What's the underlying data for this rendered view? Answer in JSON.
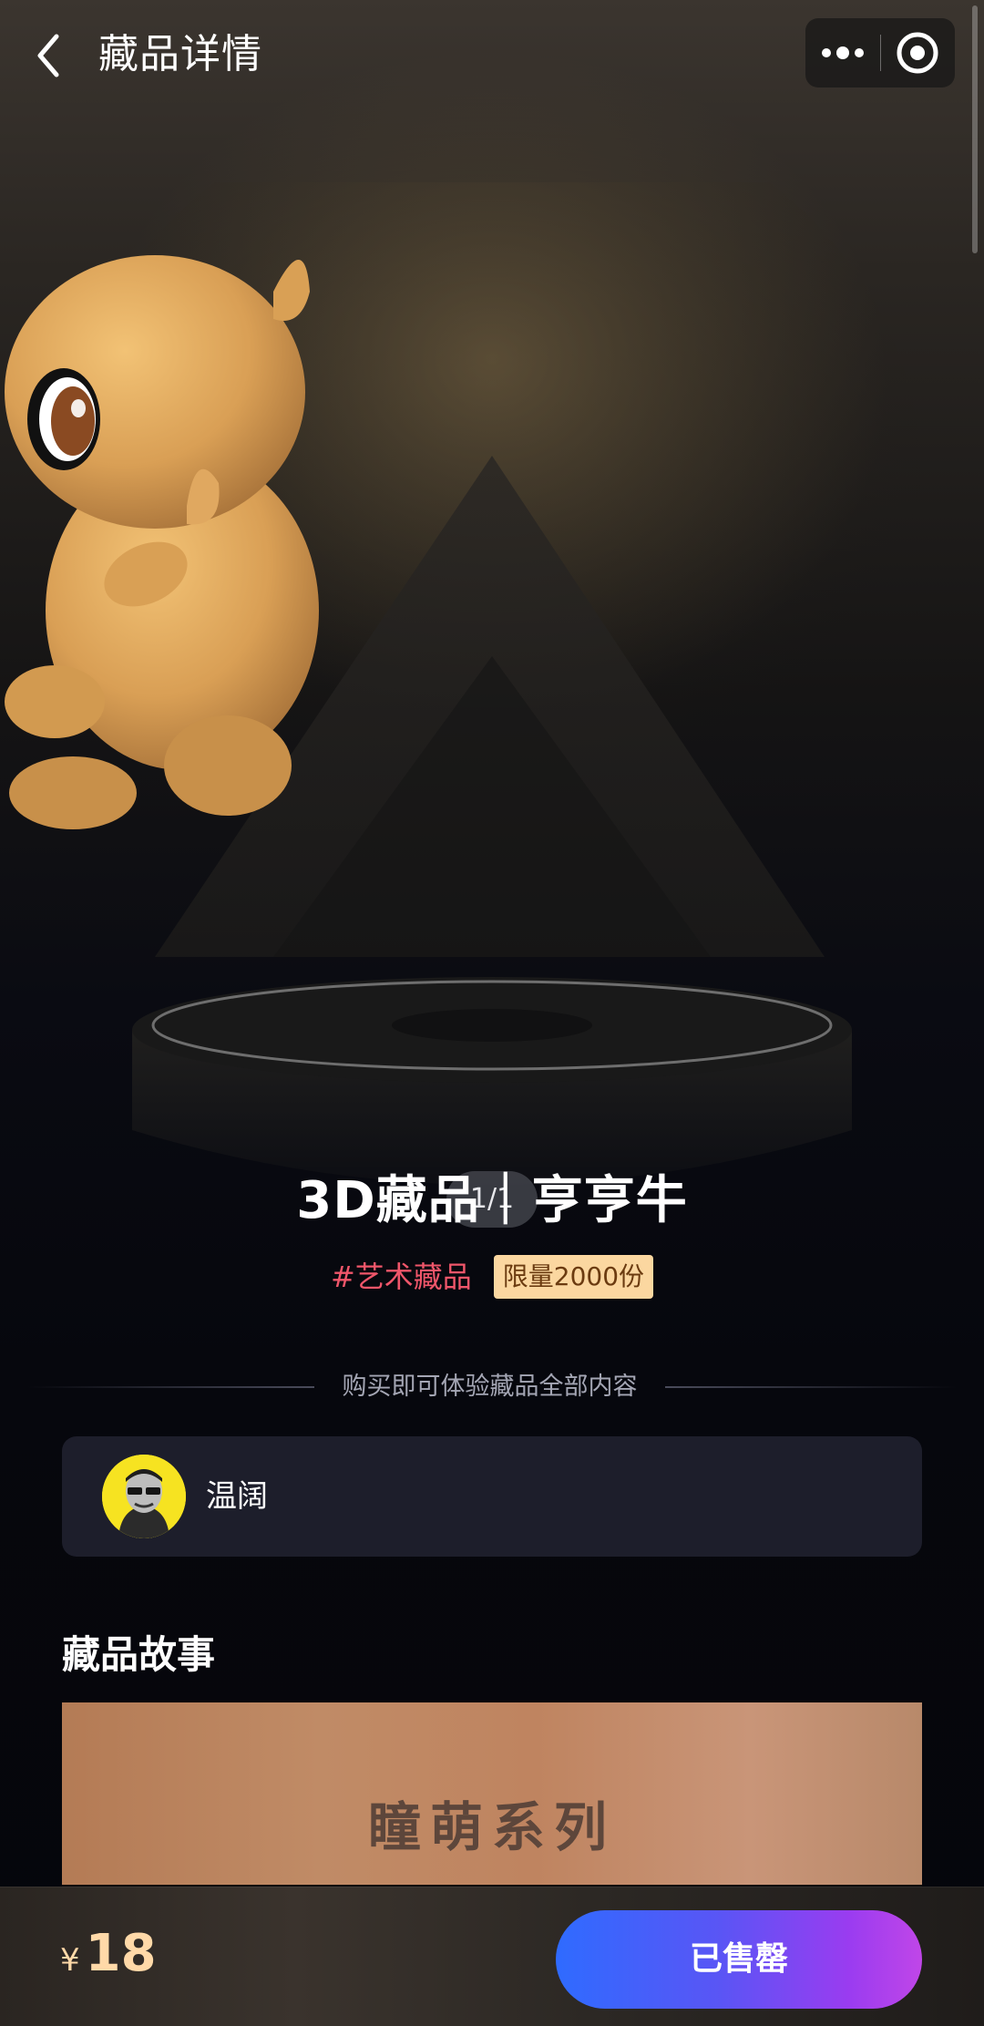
{
  "header": {
    "title": "藏品详情",
    "back_icon": "chevron-left-icon",
    "more_icon": "more-dots-icon",
    "close_icon": "close-circle-icon"
  },
  "viewer": {
    "pager": "1/1"
  },
  "item": {
    "title": "3D藏品｜亨亨牛",
    "category_tag": "#艺术藏品",
    "limit_tag": "限量2000份"
  },
  "note": "购买即可体验藏品全部内容",
  "creator": {
    "name": "温阔"
  },
  "story": {
    "heading": "藏品故事",
    "banner_text": "瞳萌系列"
  },
  "purchase": {
    "currency": "¥",
    "price": "18",
    "button_label": "已售罄"
  },
  "colors": {
    "tag_category": "#f0566a",
    "tag_limit_bg": "#fbd7a0",
    "price": "#ffd9a8",
    "button_gradient_start": "#2f6bff",
    "button_gradient_end": "#c046e8",
    "card_bg": "#1d1e2b"
  }
}
